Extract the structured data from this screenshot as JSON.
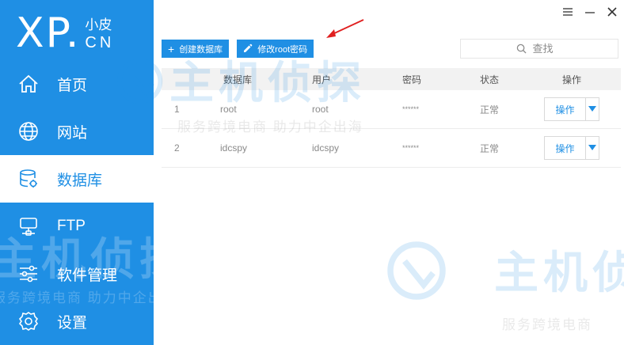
{
  "logo": {
    "main": "XP.",
    "cn": "小皮",
    "en": "CN"
  },
  "sidebar": {
    "items": [
      {
        "label": "首页",
        "icon": "home-icon"
      },
      {
        "label": "网站",
        "icon": "globe-icon"
      },
      {
        "label": "数据库",
        "icon": "database-icon",
        "active": true
      },
      {
        "label": "FTP",
        "icon": "server-icon"
      },
      {
        "label": "软件管理",
        "icon": "sliders-icon"
      },
      {
        "label": "设置",
        "icon": "gear-icon"
      }
    ]
  },
  "toolbar": {
    "create_label": "创建数据库",
    "change_pwd_label": "修改root密码"
  },
  "search": {
    "placeholder": "查找"
  },
  "table": {
    "headers": [
      "数据库",
      "用户",
      "密码",
      "状态",
      "操作"
    ],
    "rows": [
      {
        "id": "1",
        "database": "root",
        "user": "root",
        "password": "******",
        "status": "正常",
        "action": "操作"
      },
      {
        "id": "2",
        "database": "idcspy",
        "user": "idcspy",
        "password": "******",
        "status": "正常",
        "action": "操作"
      }
    ]
  },
  "watermark": {
    "title": "主机侦探",
    "subtitle": "服务跨境电商 助力中企出海",
    "subtitle_short": "服务跨境电商"
  },
  "colors": {
    "accent": "#1f8fe4",
    "annotation_arrow": "#e02020"
  }
}
